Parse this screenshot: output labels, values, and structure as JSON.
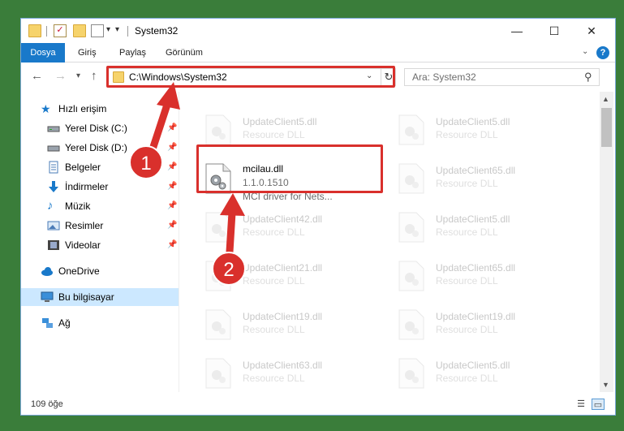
{
  "window": {
    "title": "System32"
  },
  "controls": {
    "minimize": "—",
    "maximize": "☐",
    "close": "✕"
  },
  "ribbon": {
    "tabs": [
      "Dosya",
      "Giriş",
      "Paylaş",
      "Görünüm"
    ],
    "help": "?"
  },
  "address": {
    "path": "C:\\Windows\\System32"
  },
  "search": {
    "placeholder": "Ara: System32"
  },
  "sidebar": {
    "items": [
      {
        "label": "Hızlı erişim",
        "icon": "star-icon"
      },
      {
        "label": "Yerel Disk (C:)",
        "icon": "drive-icon",
        "pinned": true
      },
      {
        "label": "Yerel Disk (D:)",
        "icon": "drive-icon",
        "pinned": true
      },
      {
        "label": "Belgeler",
        "icon": "documents-icon",
        "pinned": true
      },
      {
        "label": "İndirmeler",
        "icon": "downloads-icon",
        "pinned": true
      },
      {
        "label": "Müzik",
        "icon": "music-icon",
        "pinned": true
      },
      {
        "label": "Resimler",
        "icon": "pictures-icon",
        "pinned": true
      },
      {
        "label": "Videolar",
        "icon": "videos-icon",
        "pinned": true
      },
      {
        "label": "OneDrive",
        "icon": "cloud-icon"
      },
      {
        "label": "Bu bilgisayar",
        "icon": "computer-icon",
        "selected": true
      },
      {
        "label": "Ağ",
        "icon": "network-icon"
      }
    ]
  },
  "files": {
    "col1": [
      {
        "name": "UpdateClient5.dll",
        "desc": "Resource DLL",
        "faded": true
      },
      {
        "name": "mcilau.dll",
        "desc": "1.1.0.1510",
        "desc2": "MCI driver for Nets...",
        "faded": false
      },
      {
        "name": "UpdateClient42.dll",
        "desc": "Resource DLL",
        "faded": true
      },
      {
        "name": "UpdateClient21.dll",
        "desc": "Resource DLL",
        "faded": true
      },
      {
        "name": "UpdateClient19.dll",
        "desc": "Resource DLL",
        "faded": true
      },
      {
        "name": "UpdateClient63.dll",
        "desc": "Resource DLL",
        "faded": true
      }
    ],
    "col2": [
      {
        "name": "UpdateClient5.dll",
        "desc": "Resource DLL"
      },
      {
        "name": "UpdateClient65.dll",
        "desc": "Resource DLL"
      },
      {
        "name": "UpdateClient5.dll",
        "desc": "Resource DLL"
      },
      {
        "name": "UpdateClient65.dll",
        "desc": "Resource DLL"
      },
      {
        "name": "UpdateClient19.dll",
        "desc": "Resource DLL"
      },
      {
        "name": "UpdateClient5.dll",
        "desc": "Resource DLL"
      }
    ]
  },
  "status": {
    "count": "109 öğe"
  },
  "annotations": {
    "step1": "1",
    "step2": "2",
    "color": "#d9302c"
  }
}
